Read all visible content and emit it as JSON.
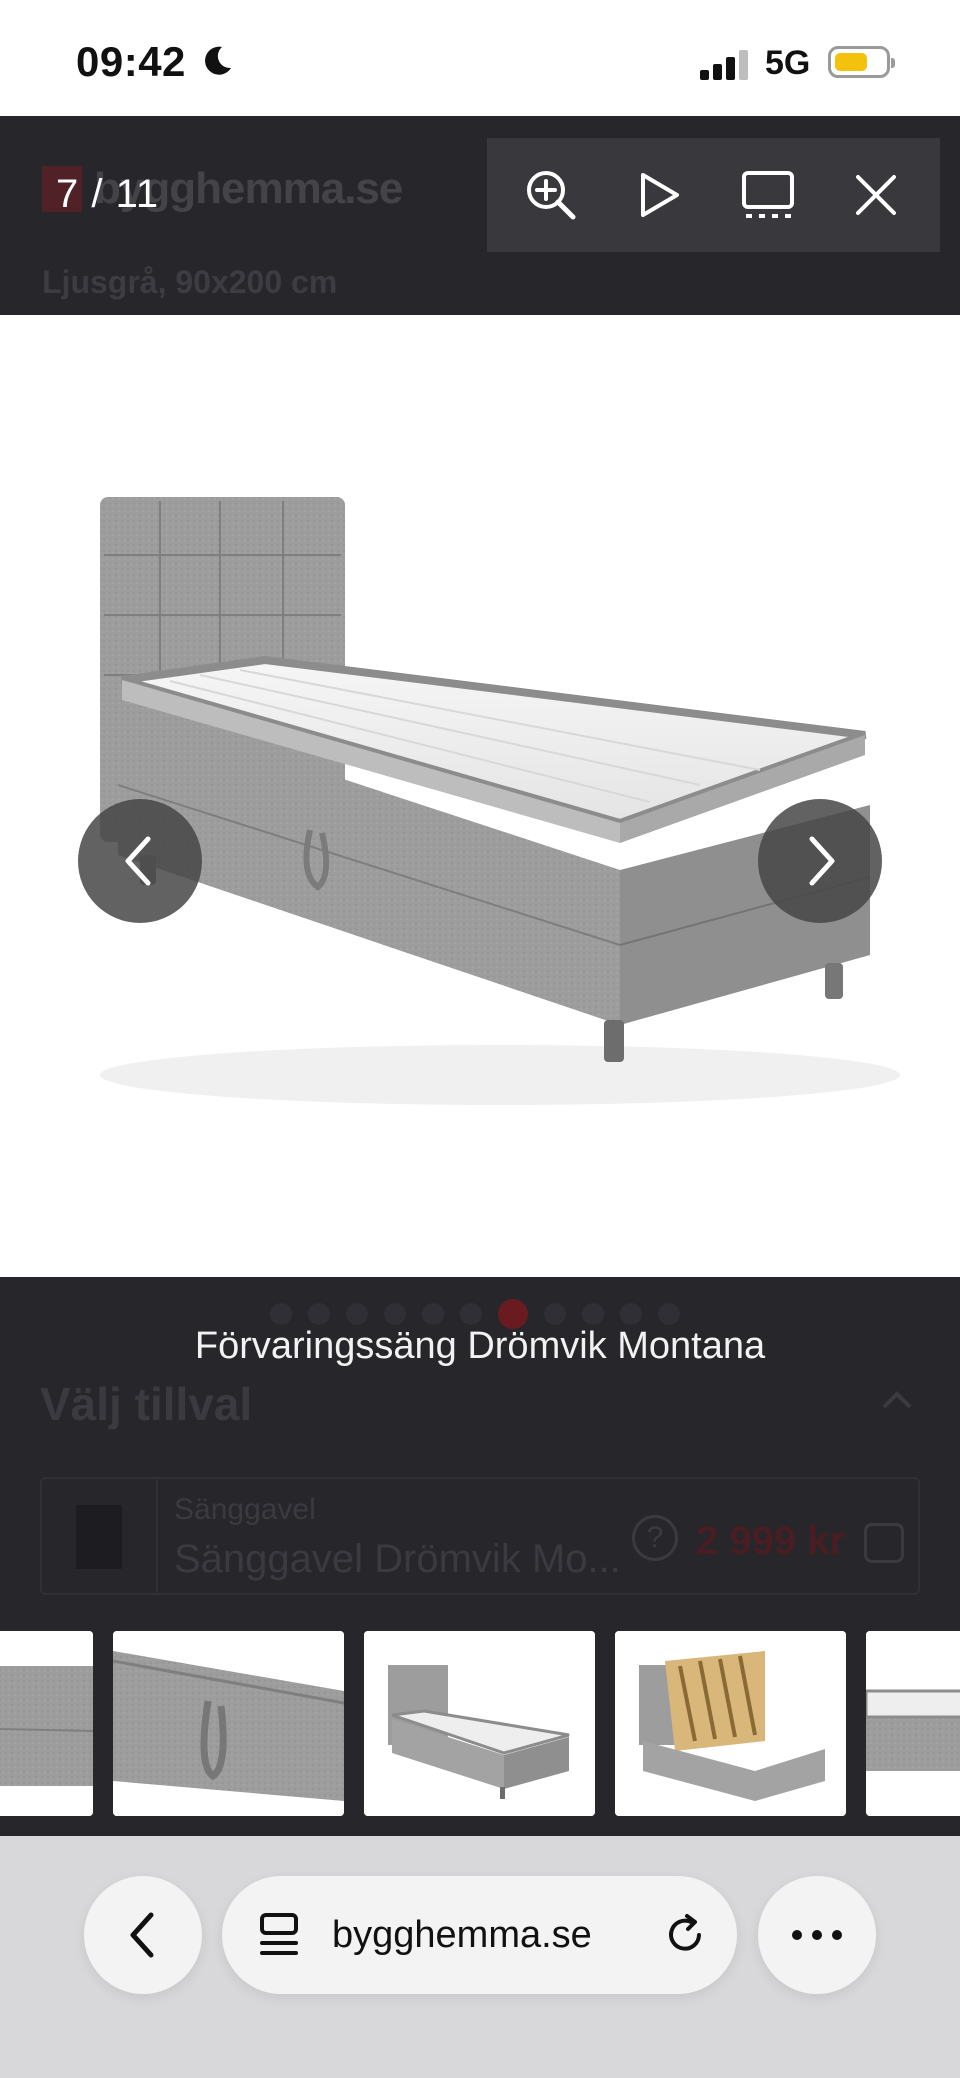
{
  "status_bar": {
    "time": "09:42",
    "network": "5G"
  },
  "background_page": {
    "logo_text": "bygghemma.se",
    "variant": "Ljusgrå, 90x200 cm",
    "section_title": "Välj tillval",
    "option": {
      "label": "Sänggavel",
      "name": "Sänggavel Drömvik Mo...",
      "price": "2 999 kr"
    }
  },
  "viewer": {
    "counter": "7 / 11",
    "current_index": 7,
    "total": 11,
    "caption": "Förvaringssäng Drömvik Montana",
    "toolbar": {
      "zoom_icon": "zoom-in-icon",
      "play_icon": "play-icon",
      "thumbnails_icon": "thumbnails-icon",
      "close_icon": "close-icon"
    }
  },
  "browser": {
    "url": "bygghemma.se"
  },
  "colors": {
    "overlay": "#26262b",
    "toolbar": "#38383d",
    "brand_red": "#9e1b22",
    "bed_gray": "#9b9b9b"
  }
}
